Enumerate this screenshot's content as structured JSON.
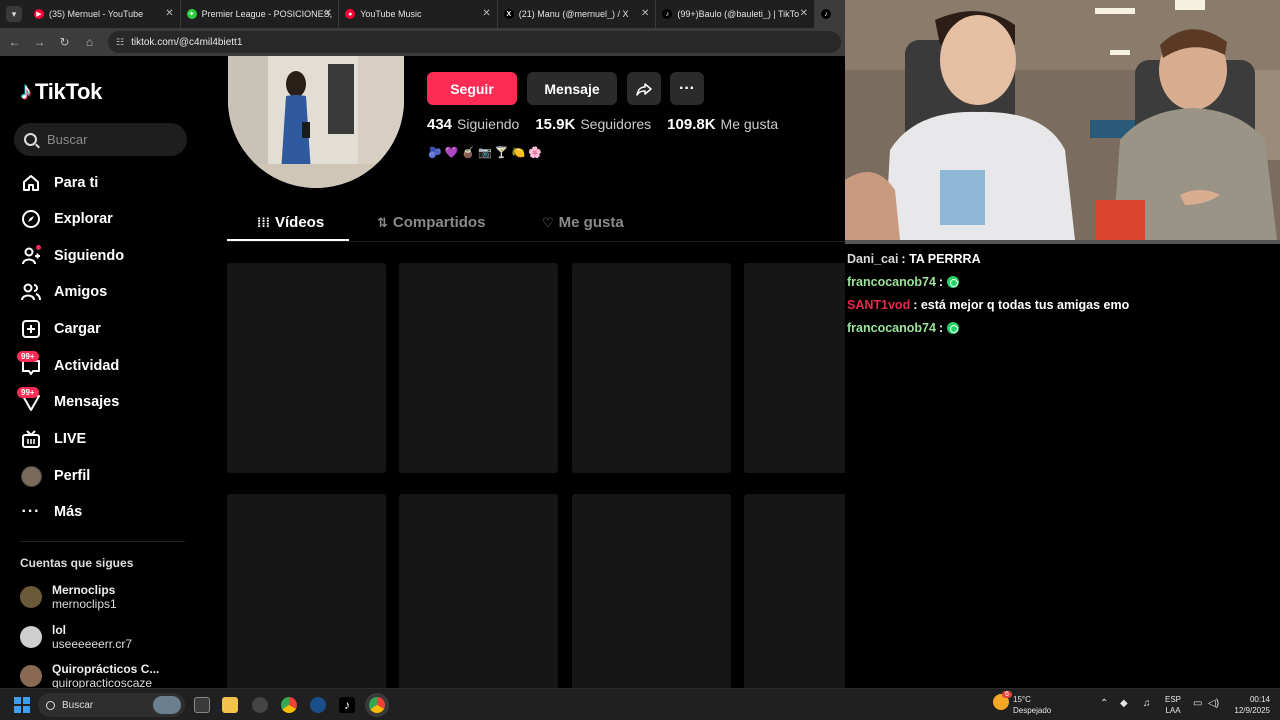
{
  "browser": {
    "tabs": [
      {
        "title": "(35) Mernuel - YouTube",
        "color": "#ff0033",
        "glyph": "▶"
      },
      {
        "title": "Premier League - POSICIONES,",
        "color": "#2ecc40",
        "glyph": "✦"
      },
      {
        "title": "YouTube Music",
        "color": "#ff0033",
        "glyph": "●"
      },
      {
        "title": "(21) Manu (@mernuel_) / X",
        "color": "#000000",
        "glyph": "X"
      },
      {
        "title": "(99+)Baulo (@bauleti_) | TikTo",
        "color": "#000000",
        "glyph": "♪"
      }
    ],
    "url": "tiktok.com/@c4mil4biett1"
  },
  "tiktok": {
    "logo_text": "TikTok",
    "search_placeholder": "Buscar",
    "nav": [
      {
        "label": "Para ti",
        "icon": "home-icon"
      },
      {
        "label": "Explorar",
        "icon": "compass-icon"
      },
      {
        "label": "Siguiendo",
        "icon": "following-icon"
      },
      {
        "label": "Amigos",
        "icon": "friends-icon"
      },
      {
        "label": "Cargar",
        "icon": "upload-icon"
      },
      {
        "label": "Actividad",
        "icon": "inbox-icon",
        "badge": "99+"
      },
      {
        "label": "Mensajes",
        "icon": "messages-icon",
        "badge": "99+"
      },
      {
        "label": "LIVE",
        "icon": "live-icon"
      },
      {
        "label": "Perfil",
        "icon": "avatar"
      },
      {
        "label": "Más",
        "icon": "more-icon"
      }
    ],
    "following_header": "Cuentas que sigues",
    "following": [
      {
        "name": "Mernoclips",
        "handle": "mernoclips1",
        "color": "#6b5a3a"
      },
      {
        "name": "lol",
        "handle": "useeeeeerr.cr7",
        "color": "#cfcfcf"
      },
      {
        "name": "Quiroprácticos C...",
        "handle": "quiropracticoscaze",
        "color": "#8a6a55"
      }
    ],
    "profile": {
      "follow_label": "Seguir",
      "message_label": "Mensaje",
      "following_count": "434",
      "following_label": "Siguiendo",
      "followers_count": "15.9K",
      "followers_label": "Seguidores",
      "likes_count": "109.8K",
      "likes_label": "Me gusta",
      "bio_emojis": "🫐💜🧉📷🍸🍋🌸"
    },
    "profile_tabs": [
      {
        "label": "Vídeos",
        "icon": "grid-icon"
      },
      {
        "label": "Compartidos",
        "icon": "repost-icon"
      },
      {
        "label": "Me gusta",
        "icon": "heart-icon"
      }
    ]
  },
  "chat": [
    {
      "user": "Dani_cai",
      "user_color": "#d9d9d9",
      "text": "TA PERRRA",
      "emote": false
    },
    {
      "user": "francocanob74",
      "user_color": "#9be29b",
      "text": "",
      "emote": true
    },
    {
      "user": "SANT1vod",
      "user_color": "#e8274b",
      "text": "está mejor q todas tus amigas emo",
      "emote": false
    },
    {
      "user": "francocanob74",
      "user_color": "#9be29b",
      "text": "",
      "emote": true
    }
  ],
  "taskbar": {
    "search_label": "Buscar",
    "weather_temp": "15°C",
    "weather_desc": "Despejado",
    "lang_top": "ESP",
    "lang_bottom": "LAA",
    "time": "00:14",
    "date": "12/9/2025",
    "weather_badge": "6"
  }
}
